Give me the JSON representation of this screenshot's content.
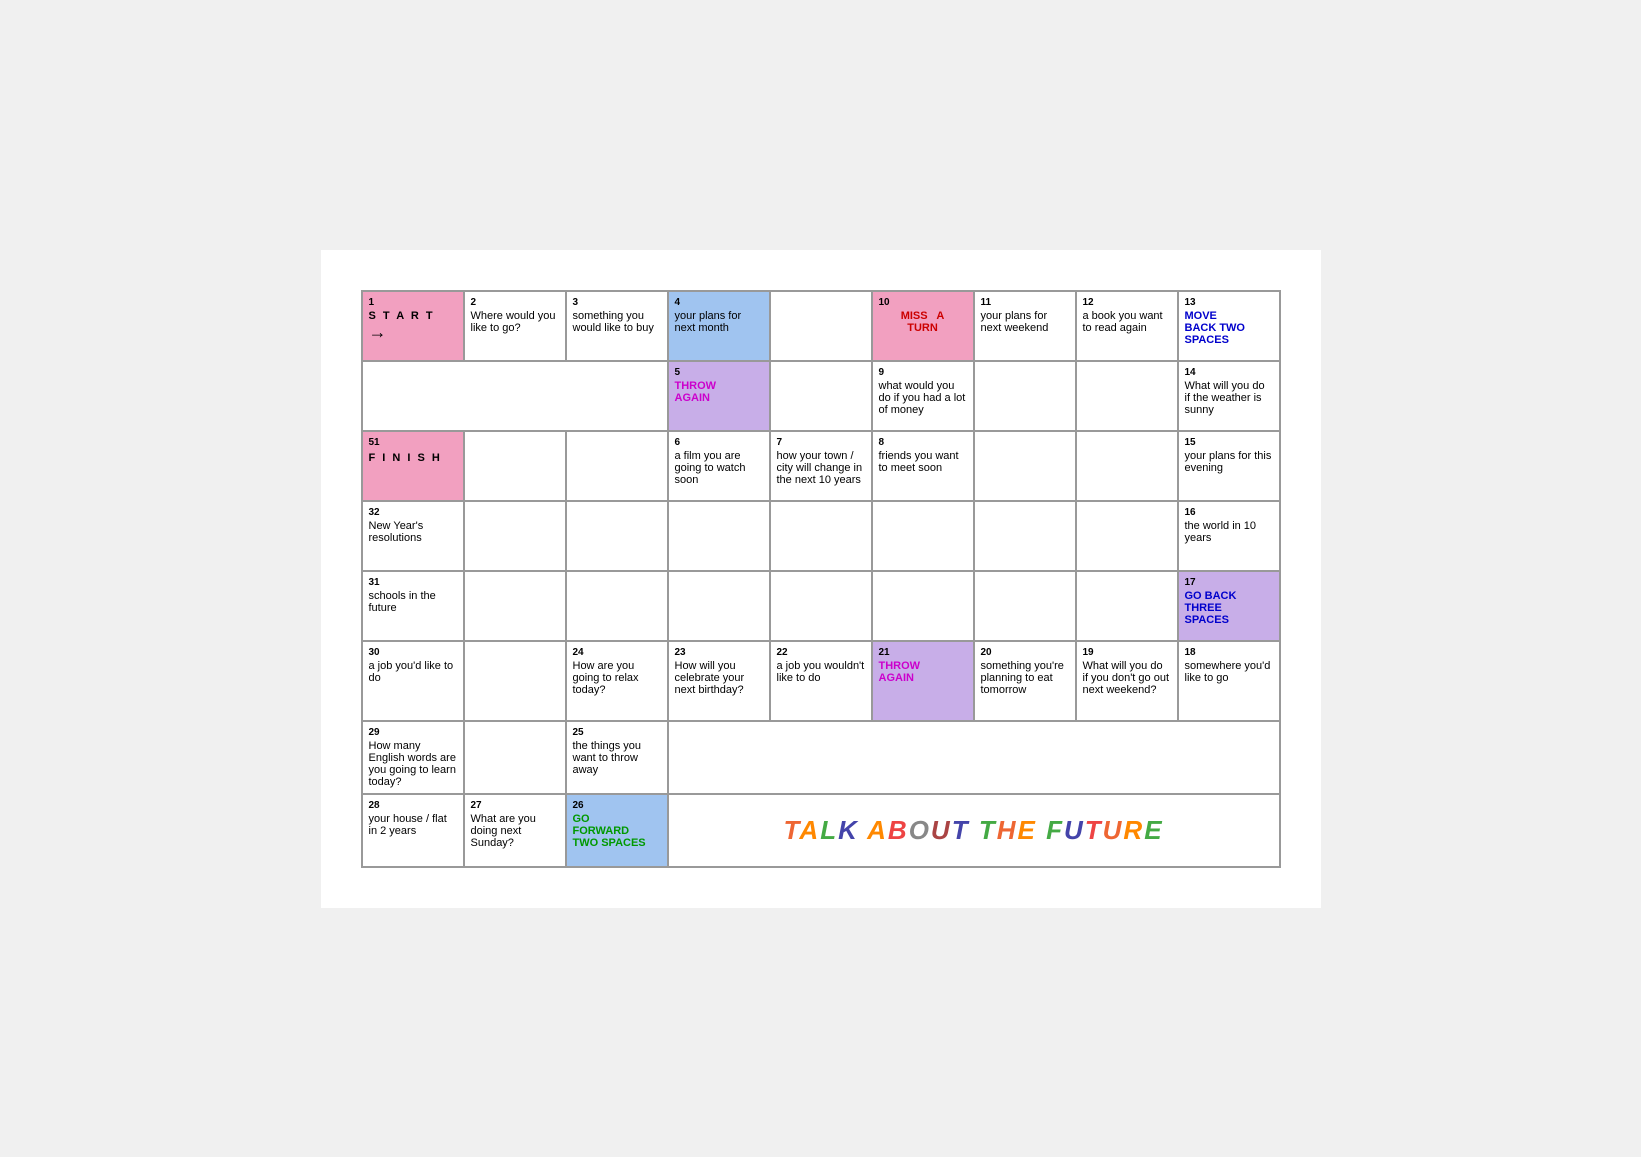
{
  "title": "TALK ABOUT THE FUTURE",
  "cells": [
    {
      "id": "1",
      "num": "1",
      "text": "S T A R T →",
      "type": "pink",
      "col": 1,
      "row": 1
    },
    {
      "id": "2",
      "num": "2",
      "text": "Where would you like to go?",
      "type": "white",
      "col": 2,
      "row": 1
    },
    {
      "id": "3",
      "num": "3",
      "text": "something you would like to buy",
      "type": "white",
      "col": 3,
      "row": 1
    },
    {
      "id": "4",
      "num": "4",
      "text": "your plans for next month",
      "type": "blue",
      "col": 4,
      "row": 1
    },
    {
      "id": "10",
      "num": "10",
      "text": "MISS A TURN",
      "type": "pink",
      "col": 6,
      "row": 1
    },
    {
      "id": "11",
      "num": "11",
      "text": "your plans for next weekend",
      "type": "white",
      "col": 7,
      "row": 1
    },
    {
      "id": "12",
      "num": "12",
      "text": "a book you want to read again",
      "type": "white",
      "col": 8,
      "row": 1
    },
    {
      "id": "13",
      "num": "13",
      "text": "MOVE BACK TWO SPACES",
      "type": "lavender",
      "col": 9,
      "row": 1
    },
    {
      "id": "5",
      "num": "5",
      "text": "THROW AGAIN",
      "type": "lavender",
      "col": 4,
      "row": 2
    },
    {
      "id": "9",
      "num": "9",
      "text": "what would you do if you had a lot of money",
      "type": "white",
      "col": 6,
      "row": 2
    },
    {
      "id": "14",
      "num": "14",
      "text": "What will you do if the weather is sunny",
      "type": "white",
      "col": 9,
      "row": 2
    },
    {
      "id": "51",
      "num": "51",
      "text": "F I N I S H",
      "type": "pink",
      "col": 1,
      "row": 3
    },
    {
      "id": "6",
      "num": "6",
      "text": "a film you are going to watch soon",
      "type": "white",
      "col": 4,
      "row": 3
    },
    {
      "id": "7",
      "num": "7",
      "text": "how your town / city will change in the next 10 years",
      "type": "white",
      "col": 5,
      "row": 3
    },
    {
      "id": "8",
      "num": "8",
      "text": "friends you want to meet soon",
      "type": "white",
      "col": 6,
      "row": 3
    },
    {
      "id": "15",
      "num": "15",
      "text": "your plans for this evening",
      "type": "white",
      "col": 9,
      "row": 3
    },
    {
      "id": "32",
      "num": "32",
      "text": "New Year's resolutions",
      "type": "white",
      "col": 1,
      "row": 4
    },
    {
      "id": "16",
      "num": "16",
      "text": "the world in 10 years",
      "type": "white",
      "col": 9,
      "row": 4
    },
    {
      "id": "31",
      "num": "31",
      "text": "schools in the future",
      "type": "white",
      "col": 1,
      "row": 5
    },
    {
      "id": "17",
      "num": "17",
      "text": "GO BACK THREE SPACES",
      "type": "lavender",
      "col": 9,
      "row": 5
    },
    {
      "id": "30",
      "num": "30",
      "text": "a job you'd like to do",
      "type": "white",
      "col": 1,
      "row": 6
    },
    {
      "id": "24",
      "num": "24",
      "text": "How are you going to relax today?",
      "type": "white",
      "col": 3,
      "row": 6
    },
    {
      "id": "23",
      "num": "23",
      "text": "How will you celebrate your next birthday?",
      "type": "white",
      "col": 4,
      "row": 6
    },
    {
      "id": "22",
      "num": "22",
      "text": "a job you wouldn't like to do",
      "type": "white",
      "col": 5,
      "row": 6
    },
    {
      "id": "21",
      "num": "21",
      "text": "THROW AGAIN",
      "type": "lavender",
      "col": 6,
      "row": 6
    },
    {
      "id": "20",
      "num": "20",
      "text": "something you're planning to eat tomorrow",
      "type": "white",
      "col": 7,
      "row": 6
    },
    {
      "id": "19",
      "num": "19",
      "text": "What will you do if you don't go out next weekend?",
      "type": "white",
      "col": 8,
      "row": 6
    },
    {
      "id": "18",
      "num": "18",
      "text": "somewhere you'd like to go",
      "type": "white",
      "col": 9,
      "row": 6
    },
    {
      "id": "29",
      "num": "29",
      "text": "How many English words are you going to learn today?",
      "type": "white",
      "col": 1,
      "row": 7
    },
    {
      "id": "25",
      "num": "25",
      "text": "the things you want to throw away",
      "type": "white",
      "col": 3,
      "row": 7
    },
    {
      "id": "28",
      "num": "28",
      "text": "your house / flat in 2 years",
      "type": "white",
      "col": 1,
      "row": 8
    },
    {
      "id": "27",
      "num": "27",
      "text": "What are you doing next Sunday?",
      "type": "white",
      "col": 2,
      "row": 8
    },
    {
      "id": "26",
      "num": "26",
      "text": "GO FORWARD TWO SPACES",
      "type": "blue",
      "col": 3,
      "row": 8
    }
  ]
}
